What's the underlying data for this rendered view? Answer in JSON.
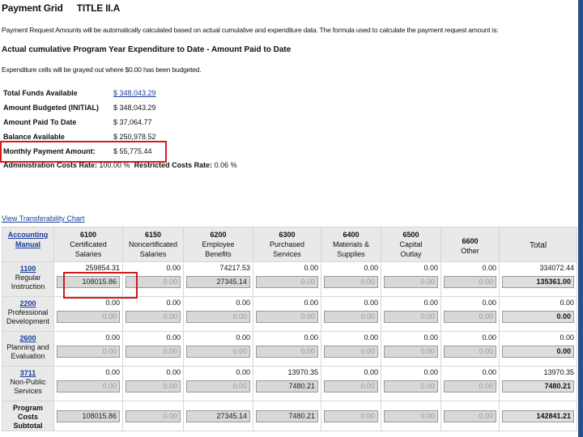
{
  "header": {
    "title": "Payment Grid",
    "subtitle": "TITLE II.A"
  },
  "desc1": "Payment Request Amounts will be automatically calculated based on actual cumulative and expenditure data. The formula used to calculate the payment request amount is:",
  "formula": "Actual cumulative Program Year Expenditure to Date - Amount Paid to Date",
  "desc2": "Expenditure cells will be grayed out where $0.00 has been budgeted.",
  "summary": {
    "total_funds_label": "Total Funds Available",
    "total_funds_value": "$ 348,043.29",
    "amount_budgeted_label": "Amount Budgeted  (INITIAL)",
    "amount_budgeted_value": "$ 348,043.29",
    "amount_paid_label": "Amount Paid To Date",
    "amount_paid_value": "$ 37,064.77",
    "balance_label": "Balance Available",
    "balance_value": "$ 250,978.52",
    "monthly_label": "Monthly Payment Amount:",
    "monthly_value": "$ 55,775.44",
    "admin_label": "Administration Costs Rate:",
    "admin_value": "100.00 %",
    "restricted_label": "Restricted Costs Rate:",
    "restricted_value": "0.06 %"
  },
  "chart_link": "View Transferability Chart",
  "grid": {
    "acct_header_1": "Accounting",
    "acct_header_2": "Manual",
    "columns": [
      {
        "code": "6100",
        "name1": "Certificated",
        "name2": "Salaries"
      },
      {
        "code": "6150",
        "name1": "Noncertificated",
        "name2": "Salaries"
      },
      {
        "code": "6200",
        "name1": "Employee",
        "name2": "Benefits"
      },
      {
        "code": "6300",
        "name1": "Purchased",
        "name2": "Services"
      },
      {
        "code": "6400",
        "name1": "Materials &",
        "name2": "Supplies"
      },
      {
        "code": "6500",
        "name1": "Capital",
        "name2": "Outlay"
      },
      {
        "code": "6600",
        "name1": "Other",
        "name2": ""
      }
    ],
    "total_header": "Total",
    "rows": [
      {
        "code": "1100",
        "name1": "Regular",
        "name2": "Instruction",
        "name3": "",
        "tops": [
          "259854.31",
          "0.00",
          "74217.53",
          "0.00",
          "0.00",
          "0.00",
          "0.00",
          "334072.44"
        ],
        "inputs": [
          "108015.86",
          "0.00",
          "27345.14",
          "0.00",
          "0.00",
          "0.00",
          "0.00",
          "135361.00"
        ]
      },
      {
        "code": "2200",
        "name1": "Professional",
        "name2": "Development",
        "name3": "",
        "tops": [
          "0.00",
          "0.00",
          "0.00",
          "0.00",
          "0.00",
          "0.00",
          "0.00",
          "0.00"
        ],
        "inputs": [
          "0.00",
          "0.00",
          "0.00",
          "0.00",
          "0.00",
          "0.00",
          "0.00",
          "0.00"
        ]
      },
      {
        "code": "2600",
        "name1": "Planning and",
        "name2": "Evaluation",
        "name3": "",
        "tops": [
          "0.00",
          "0.00",
          "0.00",
          "0.00",
          "0.00",
          "0.00",
          "0.00",
          "0.00"
        ],
        "inputs": [
          "0.00",
          "0.00",
          "0.00",
          "0.00",
          "0.00",
          "0.00",
          "0.00",
          "0.00"
        ]
      },
      {
        "code": "3711",
        "name1": "Non-Public",
        "name2": "Services",
        "name3": "",
        "tops": [
          "0.00",
          "0.00",
          "0.00",
          "13970.35",
          "0.00",
          "0.00",
          "0.00",
          "13970.35"
        ],
        "inputs": [
          "0.00",
          "0.00",
          "0.00",
          "7480.21",
          "0.00",
          "0.00",
          "0.00",
          "7480.21"
        ]
      }
    ],
    "subtotal_label_1": "Program Costs",
    "subtotal_label_2": "Subtotal",
    "subtotals": [
      "108015.86",
      "0.00",
      "27345.14",
      "7480.21",
      "0.00",
      "0.00",
      "0.00",
      "142841.21"
    ]
  },
  "colors": {
    "link": "#1a3d99",
    "highlight": "#d41a1a",
    "cell_bg": "#e9e9e9"
  }
}
